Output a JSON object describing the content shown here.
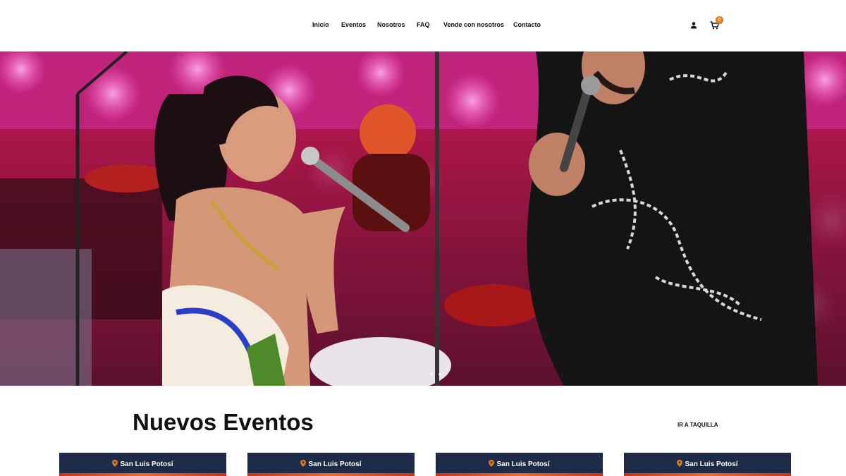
{
  "header": {
    "nav": [
      {
        "id": "inicio",
        "label": "Inicio"
      },
      {
        "id": "eventos",
        "label": "Eventos"
      },
      {
        "id": "nosotros",
        "label": "Nosotros"
      },
      {
        "id": "faq",
        "label": "FAQ"
      },
      {
        "id": "vende",
        "label": "Vende con nosotros"
      },
      {
        "id": "contacto",
        "label": "Contacto"
      }
    ],
    "icons": {
      "user": "user-icon",
      "cart": "cart-icon"
    },
    "cart_count": "0"
  },
  "hero": {
    "image": "concert-duet-photo",
    "slides_count": 2
  },
  "section": {
    "title": "Nuevos Eventos",
    "link_label": "IR A TAQUILLA"
  },
  "events": [
    {
      "location": "San Luis Potosí"
    },
    {
      "location": "San Luis Potosí"
    },
    {
      "location": "San Luis Potosí"
    },
    {
      "location": "San Luis Potosí"
    }
  ],
  "colors": {
    "accent": "#e07b1a",
    "card_bg": "#1d2a48",
    "hero_pink": "#d0287f"
  }
}
